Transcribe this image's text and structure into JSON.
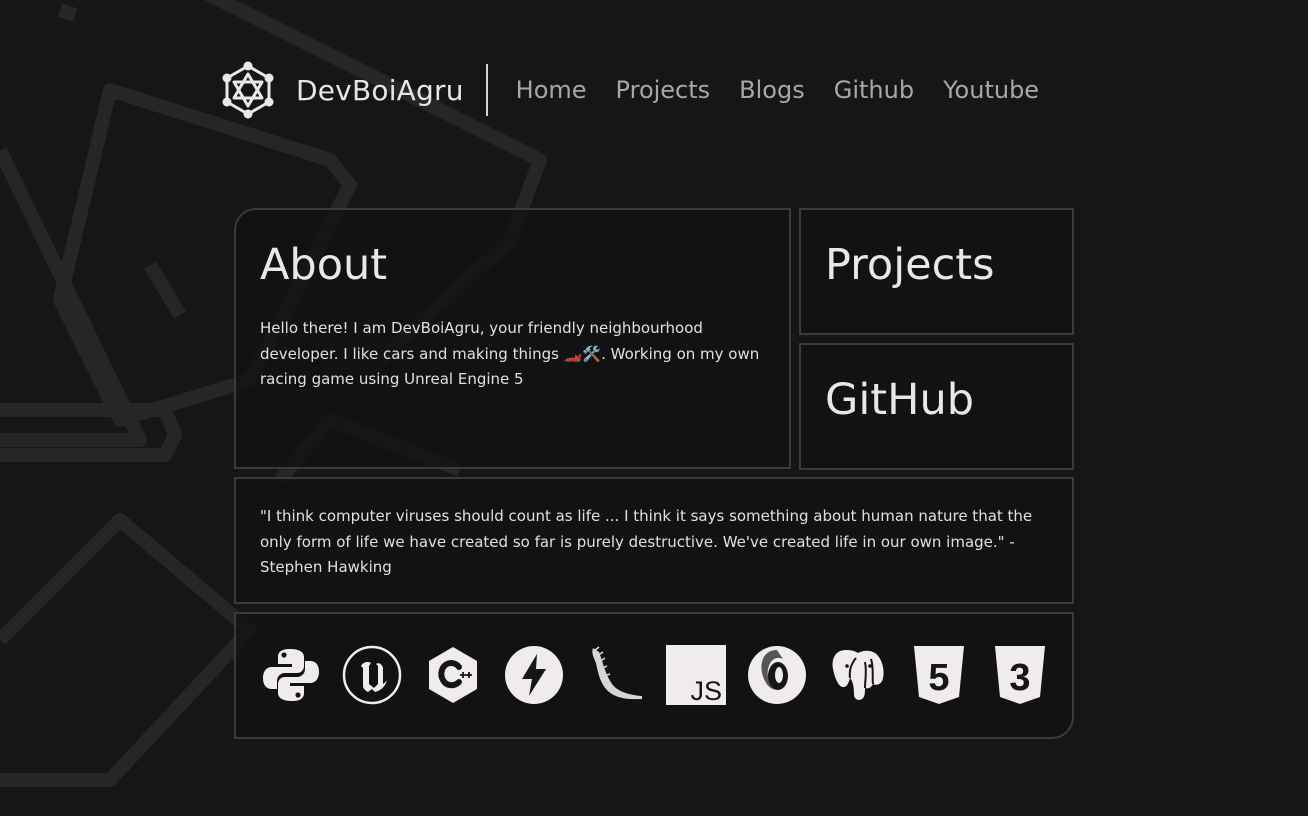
{
  "header": {
    "brand": "DevBoiAgru",
    "nav": [
      {
        "label": "Home"
      },
      {
        "label": "Projects"
      },
      {
        "label": "Blogs"
      },
      {
        "label": "Github"
      },
      {
        "label": "Youtube"
      }
    ]
  },
  "about": {
    "title": "About",
    "text": "Hello there! I am DevBoiAgru, your friendly neighbourhood developer. I like cars and making things 🏎️🛠️. Working on my own racing game using Unreal Engine 5"
  },
  "cards": {
    "projects": "Projects",
    "github": "GitHub"
  },
  "quote": {
    "text": "\"I think computer viruses should count as life ... I think it says something about human nature that the only form of life we have created so far is purely destructive. We've created life in our own image.\" - Stephen Hawking"
  },
  "tech_icons": [
    "python-icon",
    "unreal-engine-icon",
    "cpp-icon",
    "fastapi-icon",
    "flask-icon",
    "javascript-icon",
    "json-icon",
    "postgresql-icon",
    "html5-icon",
    "css3-icon"
  ],
  "tech_js_label": "JS",
  "tech_html_label": "5",
  "tech_css_label": "3",
  "colors": {
    "background": "#161616",
    "card_border": "#3b3b3b",
    "text": "#e8e4e4",
    "nav_text": "#a9a6a6"
  }
}
